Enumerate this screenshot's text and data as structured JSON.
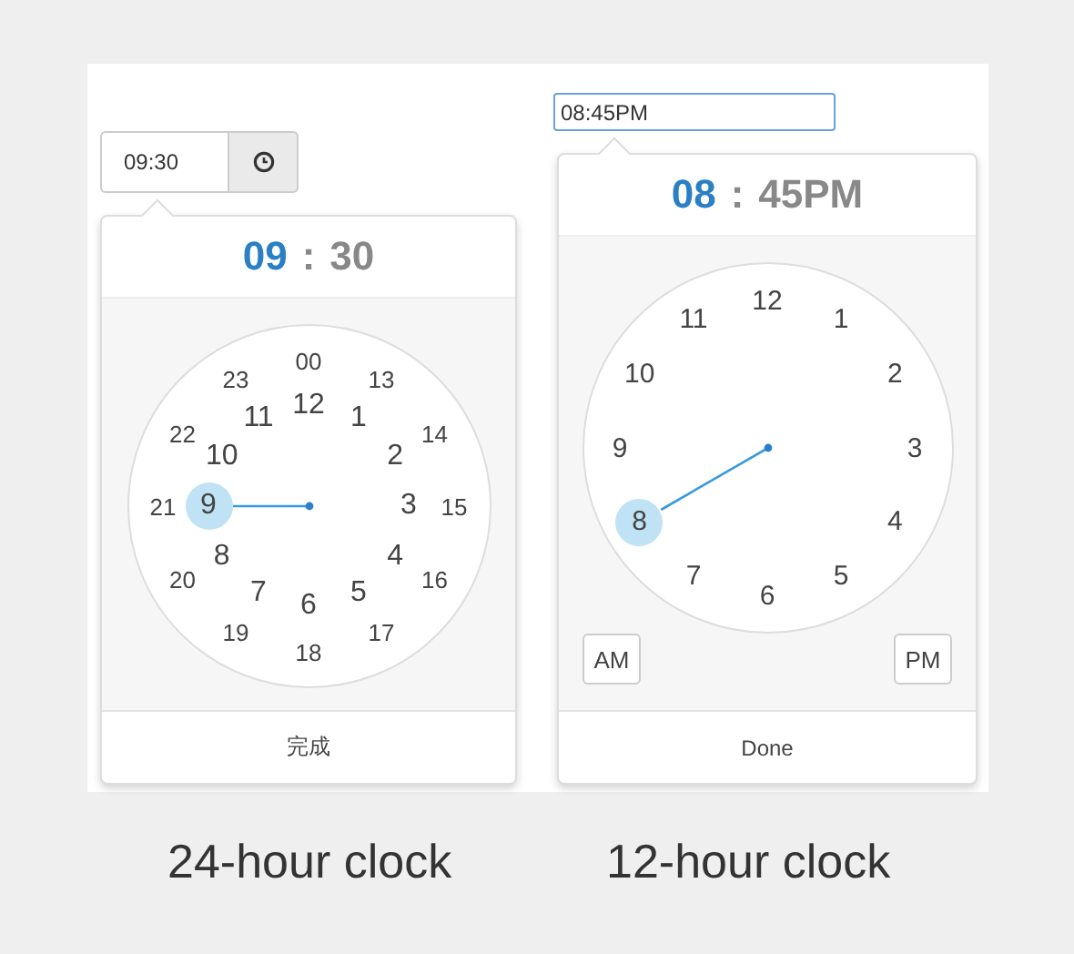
{
  "pickers": [
    {
      "input": {
        "value": "09:30",
        "kind": "addon",
        "focused": false
      },
      "display": {
        "hour": "09",
        "separator": ":",
        "minute": "30"
      },
      "rings": [
        {
          "kind": "outer",
          "right": [
            {
              "label": "00",
              "selected": false
            },
            {
              "label": "13",
              "selected": false
            },
            {
              "label": "14",
              "selected": false
            },
            {
              "label": "15",
              "selected": false
            },
            {
              "label": "16",
              "selected": false
            },
            {
              "label": "17",
              "selected": false
            }
          ],
          "left": [
            {
              "label": "23",
              "selected": false
            },
            {
              "label": "22",
              "selected": false
            },
            {
              "label": "21",
              "selected": false
            },
            {
              "label": "20",
              "selected": false
            },
            {
              "label": "19",
              "selected": false
            },
            {
              "label": "18",
              "selected": false
            }
          ]
        },
        {
          "kind": "inner",
          "right": [
            {
              "label": "12",
              "selected": false
            },
            {
              "label": "1",
              "selected": false
            },
            {
              "label": "2",
              "selected": false
            },
            {
              "label": "3",
              "selected": false
            },
            {
              "label": "4",
              "selected": false
            },
            {
              "label": "5",
              "selected": false
            }
          ],
          "left": [
            {
              "label": "11",
              "selected": false
            },
            {
              "label": "10",
              "selected": false
            },
            {
              "label": "9",
              "selected": true
            },
            {
              "label": "8",
              "selected": false
            },
            {
              "label": "7",
              "selected": false
            },
            {
              "label": "6",
              "selected": false
            }
          ]
        }
      ],
      "done": "完成",
      "caption": "24-hour clock"
    },
    {
      "input": {
        "value": "08:45PM",
        "kind": "plain",
        "focused": true
      },
      "display": {
        "hour": "08",
        "separator": ":",
        "minute": "45PM"
      },
      "rings": [
        {
          "kind": "single",
          "right": [
            {
              "label": "12",
              "selected": false
            },
            {
              "label": "1",
              "selected": false
            },
            {
              "label": "2",
              "selected": false
            },
            {
              "label": "3",
              "selected": false
            },
            {
              "label": "4",
              "selected": false
            },
            {
              "label": "5",
              "selected": false
            }
          ],
          "left": [
            {
              "label": "11",
              "selected": false
            },
            {
              "label": "10",
              "selected": false
            },
            {
              "label": "9",
              "selected": false
            },
            {
              "label": "8",
              "selected": true
            },
            {
              "label": "7",
              "selected": false
            },
            {
              "label": "6",
              "selected": false
            }
          ]
        }
      ],
      "meridiem": [
        "AM",
        "PM"
      ],
      "done": "Done",
      "caption": "12-hour clock"
    }
  ]
}
